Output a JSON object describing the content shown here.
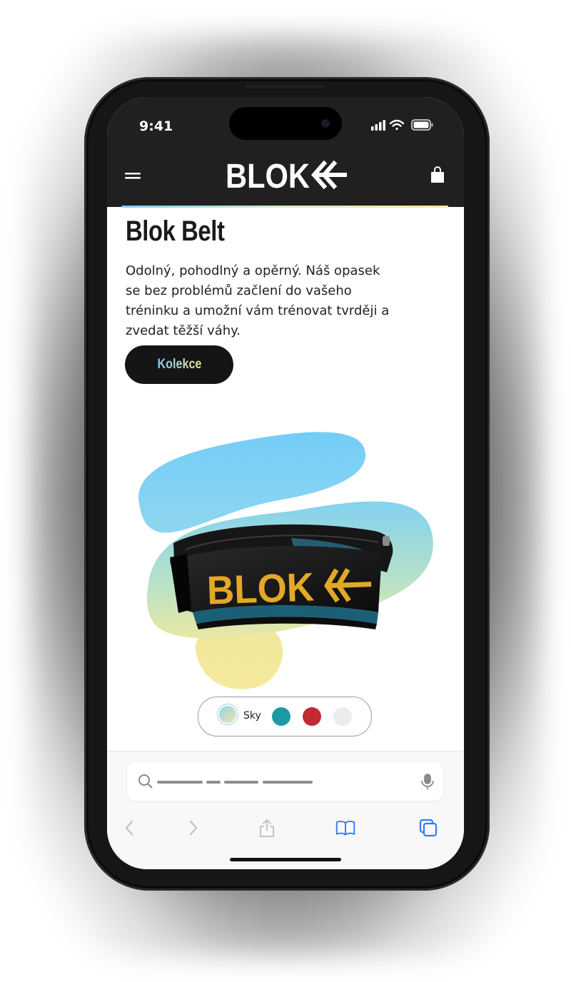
{
  "status": {
    "time": "9:41"
  },
  "header": {
    "brand": "BLOK"
  },
  "product": {
    "title": "Blok Belt",
    "description": "Odolný, pohodlný a opěrný. Náš opasek se bez problémů začlení do vašeho tréninku a umožní vám trénovat tvrději a zvedat těžší váhy.",
    "cta_label": "Kolekce",
    "belt_print": "BLOK"
  },
  "colors": {
    "selected_label": "Sky",
    "options": [
      {
        "name": "sky",
        "color": "#9ad4ee"
      },
      {
        "name": "teal",
        "color": "#1e9aa5"
      },
      {
        "name": "red",
        "color": "#c02a31"
      },
      {
        "name": "white",
        "color": "#ececec"
      }
    ]
  },
  "theme": {
    "header_bg": "#221f20",
    "accent_blue": "#7ecff5",
    "accent_yellow": "#f5e19b",
    "belt_gold": "#e3a826"
  }
}
